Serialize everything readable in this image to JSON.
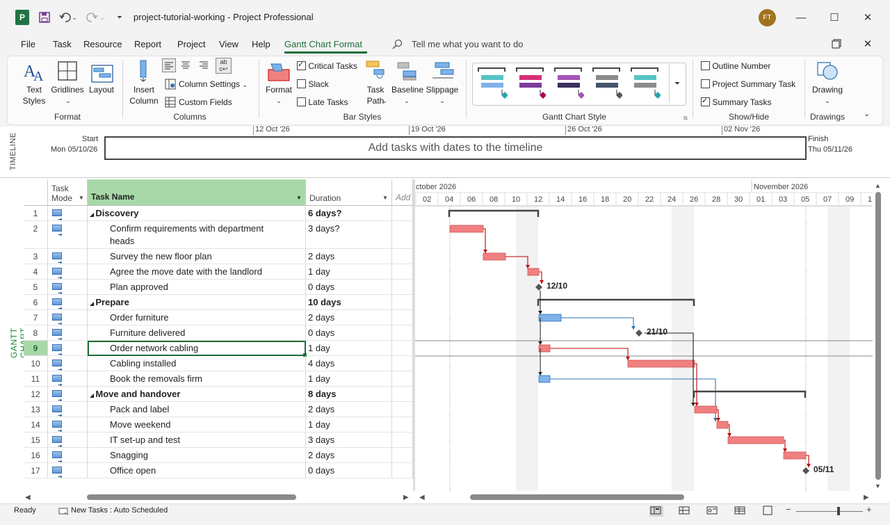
{
  "window": {
    "title": "project-tutorial-working  -  Project Professional",
    "app_icon": "P",
    "avatar_initials": "FT"
  },
  "menu": {
    "items": [
      "File",
      "Task",
      "Resource",
      "Report",
      "Project",
      "View",
      "Help"
    ],
    "active": "Gantt Chart Format",
    "tell_me": "Tell me what you want to do"
  },
  "ribbon": {
    "format_group": {
      "label": "Format",
      "text_styles": "Text\nStyles",
      "gridlines": "Gridlines",
      "layout": "Layout"
    },
    "columns_group": {
      "label": "Columns",
      "insert_column": "Insert\nColumn",
      "column_settings": "Column Settings",
      "custom_fields": "Custom Fields"
    },
    "bar_styles_group": {
      "label": "Bar Styles",
      "format": "Format",
      "critical_tasks": "Critical Tasks",
      "slack": "Slack",
      "late_tasks": "Late Tasks",
      "task_path": "Task\nPath",
      "baseline": "Baseline",
      "slippage": "Slippage"
    },
    "gantt_style_group": {
      "label": "Gantt Chart Style"
    },
    "show_hide_group": {
      "label": "Show/Hide",
      "outline_number": "Outline Number",
      "project_summary_task": "Project Summary Task",
      "summary_tasks": "Summary Tasks"
    },
    "drawings_group": {
      "label": "Drawings",
      "drawing": "Drawing"
    },
    "checkboxes": {
      "critical_tasks": true,
      "slack": false,
      "late_tasks": false,
      "outline_number": false,
      "project_summary_task": false,
      "summary_tasks": true
    }
  },
  "timeline": {
    "side_label": "TIMELINE",
    "start_label": "Start",
    "start_date": "Mon 05/10/26",
    "finish_label": "Finish",
    "finish_date": "Thu 05/11/26",
    "message": "Add tasks with dates to the timeline",
    "ticks": [
      "12 Oct '26",
      "19 Oct '26",
      "26 Oct '26",
      "02 Nov '26"
    ]
  },
  "gantt": {
    "side_label": "GANTT CHART",
    "columns": {
      "task_mode": "Task\nMode",
      "task_name": "Task Name",
      "duration": "Duration",
      "add": "Add"
    },
    "month_labels": [
      "ctober 2026",
      "November 2026"
    ],
    "day_labels": [
      "02",
      "04",
      "06",
      "08",
      "10",
      "12",
      "14",
      "16",
      "18",
      "20",
      "22",
      "24",
      "26",
      "28",
      "30",
      "01",
      "03",
      "05",
      "07",
      "09",
      "1"
    ],
    "selected_row": 9,
    "tasks": [
      {
        "id": "1",
        "name": "Discovery",
        "duration": "6 days?",
        "summary": true
      },
      {
        "id": "2",
        "name": "Confirm requirements with department",
        "name2": "heads",
        "duration": "3 days?",
        "summary": false
      },
      {
        "id": "3",
        "name": "Survey the new floor plan",
        "duration": "2 days",
        "summary": false
      },
      {
        "id": "4",
        "name": "Agree the move date with the landlord",
        "duration": "1 day",
        "summary": false
      },
      {
        "id": "5",
        "name": "Plan approved",
        "duration": "0 days",
        "summary": false
      },
      {
        "id": "6",
        "name": "Prepare",
        "duration": "10 days",
        "summary": true
      },
      {
        "id": "7",
        "name": "Order furniture",
        "duration": "2 days",
        "summary": false
      },
      {
        "id": "8",
        "name": "Furniture delivered",
        "duration": "0 days",
        "summary": false
      },
      {
        "id": "9",
        "name": "Order network cabling",
        "duration": "1 day",
        "summary": false
      },
      {
        "id": "10",
        "name": "Cabling installed",
        "duration": "4 days",
        "summary": false
      },
      {
        "id": "11",
        "name": "Book the removals firm",
        "duration": "1 day",
        "summary": false
      },
      {
        "id": "12",
        "name": "Move and handover",
        "duration": "8 days",
        "summary": true
      },
      {
        "id": "13",
        "name": "Pack and label",
        "duration": "2 days",
        "summary": false
      },
      {
        "id": "14",
        "name": "Move weekend",
        "duration": "1 day",
        "summary": false
      },
      {
        "id": "15",
        "name": "IT set-up and test",
        "duration": "3 days",
        "summary": false
      },
      {
        "id": "16",
        "name": "Snagging",
        "duration": "2 days",
        "summary": false
      },
      {
        "id": "17",
        "name": "Office open",
        "duration": "0 days",
        "summary": false
      }
    ],
    "milestone_labels": [
      "12/10",
      "21/10",
      "05/11"
    ]
  },
  "status": {
    "ready": "Ready",
    "new_tasks": "New Tasks : Auto Scheduled"
  },
  "colors": {
    "accent": "#1e6e3a",
    "critical_bar": "#f08080",
    "normal_bar": "#7fb2ea",
    "link_red": "#c00000",
    "link_blue": "#2e75b6",
    "header_green": "#a8d8a8"
  }
}
